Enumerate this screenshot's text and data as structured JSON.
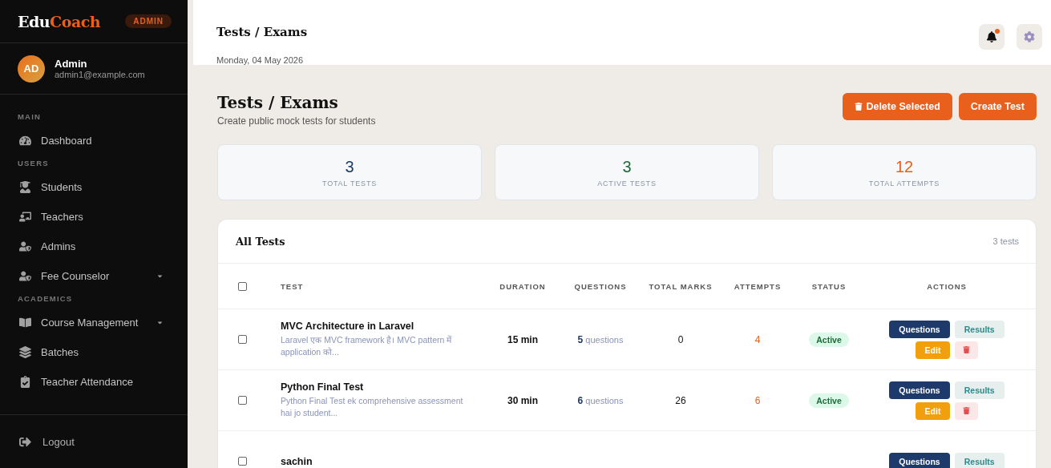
{
  "sidebar": {
    "logo": {
      "part_1": "Edu",
      "part_2": "Coach"
    },
    "role_badge": "ADMIN",
    "user": {
      "initials": "AD",
      "name": "Admin",
      "email": "admin1@example.com"
    },
    "sections": [
      {
        "label": "MAIN",
        "items": [
          {
            "label": "Dashboard",
            "expandable": false
          }
        ]
      },
      {
        "label": "USERS",
        "items": [
          {
            "label": "Students",
            "expandable": false
          },
          {
            "label": "Teachers",
            "expandable": false
          },
          {
            "label": "Admins",
            "expandable": false
          },
          {
            "label": "Fee Counselor",
            "expandable": true
          }
        ]
      },
      {
        "label": "ACADEMICS",
        "items": [
          {
            "label": "Course Management",
            "expandable": true
          },
          {
            "label": "Batches",
            "expandable": false
          },
          {
            "label": "Teacher Attendance",
            "expandable": false
          }
        ]
      }
    ],
    "logout": "Logout"
  },
  "header": {
    "title": "Tests / Exams",
    "date": "Monday, 04 May 2026",
    "notification_unread": true
  },
  "page": {
    "title": "Tests / Exams",
    "subtitle": "Create public mock tests for students",
    "buttons": [
      {
        "kind": "delete",
        "label": "Delete Selected"
      },
      {
        "kind": "create",
        "label": "Create Test"
      }
    ]
  },
  "stats": [
    {
      "value": "3",
      "label": "TOTAL TESTS",
      "color": "#1e3a6b"
    },
    {
      "value": "3",
      "label": "ACTIVE TESTS",
      "color": "#1d6b3a"
    },
    {
      "value": "12",
      "label": "TOTAL ATTEMPTS",
      "color": "#e8601c"
    }
  ],
  "table": {
    "title": "All Tests",
    "count": "3 tests",
    "select_all_checked": false,
    "columns": [
      "TEST",
      "DURATION",
      "QUESTIONS",
      "TOTAL MARKS",
      "ATTEMPTS",
      "STATUS",
      "ACTIONS"
    ],
    "rows": [
      {
        "checked": false,
        "name": "MVC Architecture in Laravel",
        "description": "Laravel एक MVC framework है। MVC pattern में application को...",
        "duration": "15 min",
        "questions_count": "5",
        "questions_unit": "questions",
        "total_marks": "0",
        "attempts": "4",
        "status": {
          "kind": "active",
          "label": "Active"
        },
        "actions": [
          "Questions",
          "Results",
          "Edit"
        ]
      },
      {
        "checked": false,
        "name": "Python Final Test",
        "description": "Python Final Test ek comprehensive assessment hai jo student...",
        "duration": "30 min",
        "questions_count": "6",
        "questions_unit": "questions",
        "total_marks": "26",
        "attempts": "6",
        "status": {
          "kind": "active",
          "label": "Active"
        },
        "actions": [
          "Questions",
          "Results",
          "Edit"
        ]
      },
      {
        "checked": false,
        "name": "sachin",
        "actions": [
          "Questions",
          "Results"
        ]
      }
    ]
  }
}
